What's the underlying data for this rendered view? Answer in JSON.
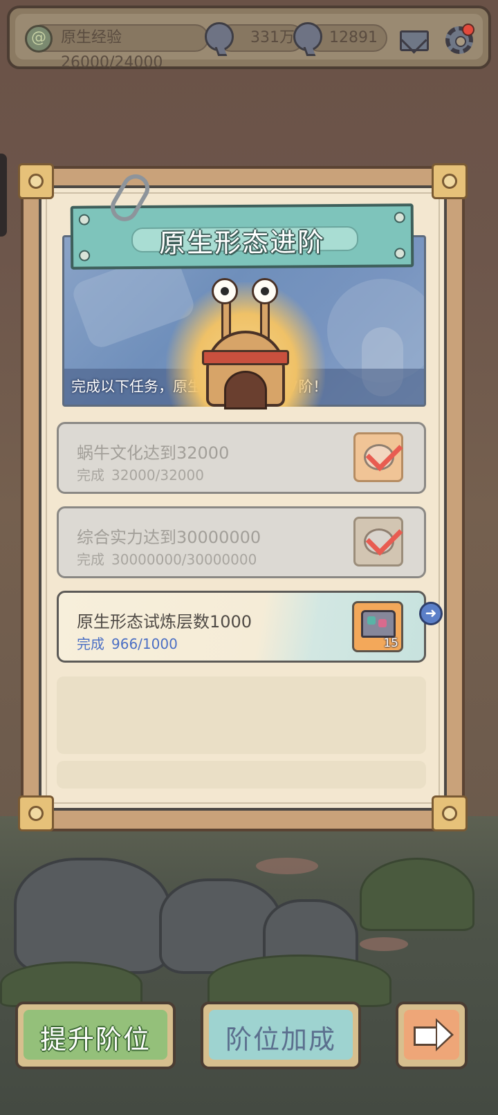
{
  "topbar": {
    "exp_label": "原生经验26000/24000",
    "resource1_value": "331万",
    "resource2_value": "12891"
  },
  "panel": {
    "title": "原生形态进阶",
    "banner_text": "完成以下任务，原生形态可提升至7阶！"
  },
  "tasks": [
    {
      "name": "蜗牛文化达到32000",
      "status": "完成",
      "progress": "32000/32000",
      "completed": true
    },
    {
      "name": "综合实力达到30000000",
      "status": "完成",
      "progress": "30000000/30000000",
      "completed": true
    },
    {
      "name": "原生形态试炼层数1000",
      "status": "完成",
      "progress": "966/1000",
      "completed": false,
      "reward_count": "15"
    }
  ],
  "buttons": {
    "upgrade_label": "提升阶位",
    "bonus_label": "阶位加成"
  },
  "icons": {
    "exp": "snail-shell-icon",
    "resource1": "speech-bubble-icon",
    "resource2": "speech-bubble-icon",
    "mail": "mail-icon",
    "settings": "gear-icon",
    "task_done": "checkmark-icon",
    "reward": "treasure-chest-icon",
    "goto": "arrow-right-icon",
    "next": "arrow-right-icon"
  },
  "colors": {
    "title_plate": "#7ec4bb",
    "progress_active": "#4b6fc4",
    "upgrade_button": "#94c07a",
    "bonus_button": "#9ed3d0",
    "next_button": "#eea678",
    "notification_dot": "#e34a3c"
  }
}
